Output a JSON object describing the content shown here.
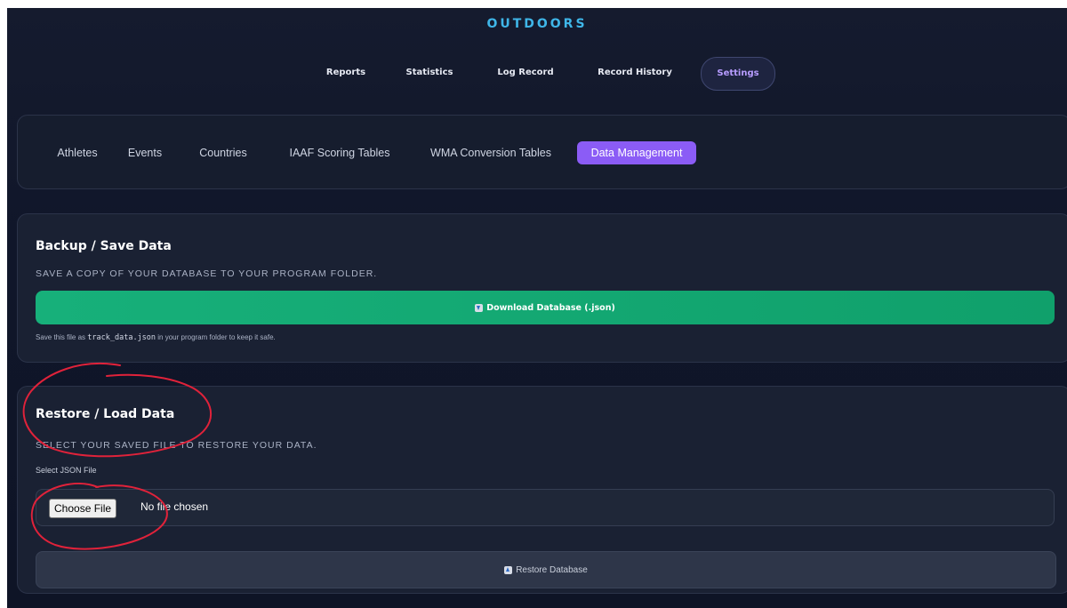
{
  "app": {
    "brand": "OUTDOORS"
  },
  "main_nav": {
    "items": [
      {
        "label": "Reports"
      },
      {
        "label": "Statistics"
      },
      {
        "label": "Log Record"
      },
      {
        "label": "Record History"
      },
      {
        "label": "Settings",
        "active": true
      }
    ]
  },
  "settings_tabs": {
    "items": [
      {
        "label": "Athletes"
      },
      {
        "label": "Events"
      },
      {
        "label": "Countries"
      },
      {
        "label": "IAAF Scoring Tables"
      },
      {
        "label": "WMA Conversion Tables"
      },
      {
        "label": "Data Management",
        "active": true
      }
    ]
  },
  "backup": {
    "title": "Backup / Save Data",
    "subtitle": "SAVE A COPY OF YOUR DATABASE TO YOUR PROGRAM FOLDER.",
    "button_label": "Download Database (.json)",
    "button_icon": "download-icon",
    "note_prefix": "Save this file as",
    "note_filename": "track_data.json",
    "note_suffix": "in your program folder to keep it safe."
  },
  "restore": {
    "title": "Restore / Load Data",
    "subtitle": "SELECT YOUR SAVED FILE TO RESTORE YOUR DATA.",
    "file_label": "Select JSON File",
    "choose_button": "Choose File",
    "file_status": "No file chosen",
    "button_label": "Restore Database",
    "button_icon": "upload-icon"
  },
  "colors": {
    "brand": "#3fb6e8",
    "active_tab": "#8b5cf6",
    "download_button": "#10a06b",
    "annotation_ink": "#e0223a"
  }
}
